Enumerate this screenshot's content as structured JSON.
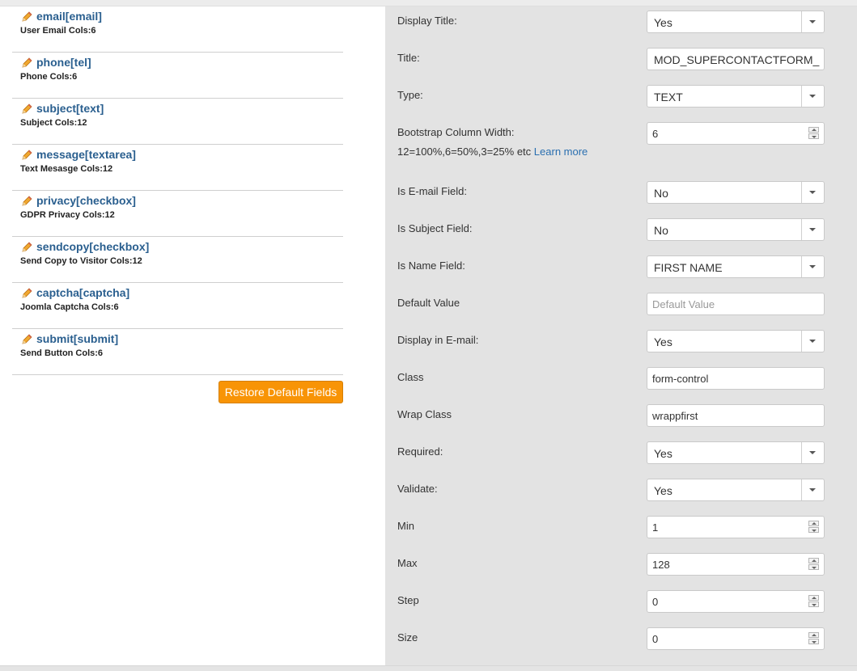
{
  "fields": [
    {
      "name": "email[email]",
      "desc": "User Email Cols:6"
    },
    {
      "name": "phone[tel]",
      "desc": "Phone Cols:6"
    },
    {
      "name": "subject[text]",
      "desc": "Subject Cols:12"
    },
    {
      "name": "message[textarea]",
      "desc": "Text Mesasge Cols:12"
    },
    {
      "name": "privacy[checkbox]",
      "desc": "GDPR Privacy Cols:12"
    },
    {
      "name": "sendcopy[checkbox]",
      "desc": "Send Copy to Visitor Cols:12"
    },
    {
      "name": "captcha[captcha]",
      "desc": "Joomla Captcha Cols:6"
    },
    {
      "name": "submit[submit]",
      "desc": "Send Button Cols:6"
    }
  ],
  "restore_button": "Restore Default Fields",
  "props": {
    "display_title": {
      "label": "Display Title:",
      "value": "Yes"
    },
    "title": {
      "label": "Title:",
      "value": "MOD_SUPERCONTACTFORM_FIE"
    },
    "type": {
      "label": "Type:",
      "value": "TEXT"
    },
    "bootstrap_width": {
      "label": "Bootstrap Column Width:",
      "help": "12=100%,6=50%,3=25% etc",
      "link": "Learn more",
      "value": "6"
    },
    "is_email": {
      "label": "Is E-mail Field:",
      "value": "No"
    },
    "is_subject": {
      "label": "Is Subject Field:",
      "value": "No"
    },
    "is_name": {
      "label": "Is Name Field:",
      "value": "FIRST NAME"
    },
    "default_value": {
      "label": "Default Value",
      "placeholder": "Default Value"
    },
    "display_in_email": {
      "label": "Display in E-mail:",
      "value": "Yes"
    },
    "class": {
      "label": "Class",
      "value": "form-control"
    },
    "wrap_class": {
      "label": "Wrap Class",
      "value": "wrappfirst"
    },
    "required": {
      "label": "Required:",
      "value": "Yes"
    },
    "validate": {
      "label": "Validate:",
      "value": "Yes"
    },
    "min": {
      "label": "Min",
      "value": "1"
    },
    "max": {
      "label": "Max",
      "value": "128"
    },
    "step": {
      "label": "Step",
      "value": "0"
    },
    "size": {
      "label": "Size",
      "value": "0"
    }
  },
  "colors": {
    "accent_button": "#f89406",
    "link": "#2a5f8f",
    "panel_bg": "#e3e3e3"
  },
  "icons": {
    "field_edit": "pencil-icon"
  }
}
